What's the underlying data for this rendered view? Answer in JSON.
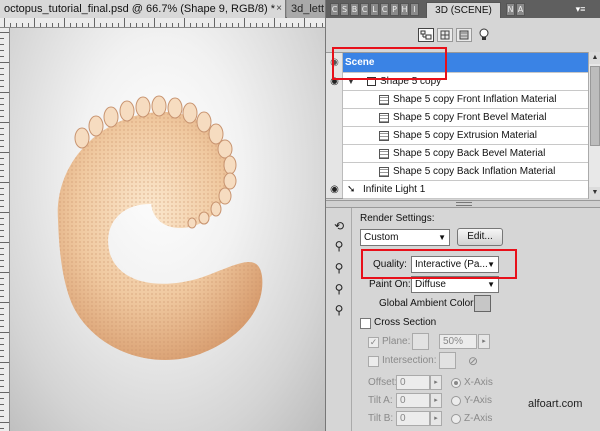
{
  "document": {
    "active_tab_title": "octopus_tutorial_final.psd @ 66.7% (Shape 9, RGB/8) *",
    "second_tab_title": "3d_lett",
    "close_symbol": "×"
  },
  "canvas": {
    "background_colors": [
      "#ffffff",
      "#bcbcbc"
    ],
    "subject": "tentacle-3d-shape"
  },
  "panel": {
    "active_tab": "3D (SCENE)",
    "icon_tab_letters": [
      "C",
      "S",
      "B",
      "C",
      "L",
      "C",
      "P",
      "H",
      "I",
      "N",
      "A"
    ],
    "menu_icon": "panel-menu-icon",
    "filter_icons": [
      "whole-scene-icon",
      "meshes-icon",
      "materials-icon",
      "lights-icon"
    ],
    "layers": [
      {
        "label": "Scene",
        "type": "scene",
        "selected": true
      },
      {
        "label": "Shape 5 copy",
        "type": "mesh",
        "expanded": true
      },
      {
        "label": "Shape 5 copy Front Inflation Material",
        "type": "material"
      },
      {
        "label": "Shape 5 copy Front Bevel Material",
        "type": "material"
      },
      {
        "label": "Shape 5 copy Extrusion Material",
        "type": "material"
      },
      {
        "label": "Shape 5 copy Back Bevel Material",
        "type": "material"
      },
      {
        "label": "Shape 5 copy Back Inflation Material",
        "type": "material"
      },
      {
        "label": "Infinite Light 1",
        "type": "light"
      }
    ],
    "selection_color": "#3a83e5"
  },
  "settings": {
    "render_settings_label": "Render Settings:",
    "render_preset": "Custom",
    "edit_button": "Edit...",
    "quality_label": "Quality:",
    "quality_value": "Interactive (Pa...",
    "paint_on_label": "Paint On:",
    "paint_on_value": "Diffuse",
    "global_ambient_label": "Global Ambient Color:",
    "ambient_color": "#c6c6c6",
    "cross_section_label": "Cross Section",
    "plane_label": "Plane:",
    "plane_opacity": "50%",
    "intersection_label": "Intersection:",
    "offset_label": "Offset:",
    "offset_value": "0",
    "tilt_a_label": "Tilt A:",
    "tilt_a_value": "0",
    "tilt_b_label": "Tilt B:",
    "tilt_b_value": "0",
    "axes": [
      "X-Axis",
      "Y-Axis",
      "Z-Axis"
    ],
    "selected_axis": "X-Axis"
  },
  "highlight_color": "#e8101a",
  "watermark": "alfoart.com"
}
